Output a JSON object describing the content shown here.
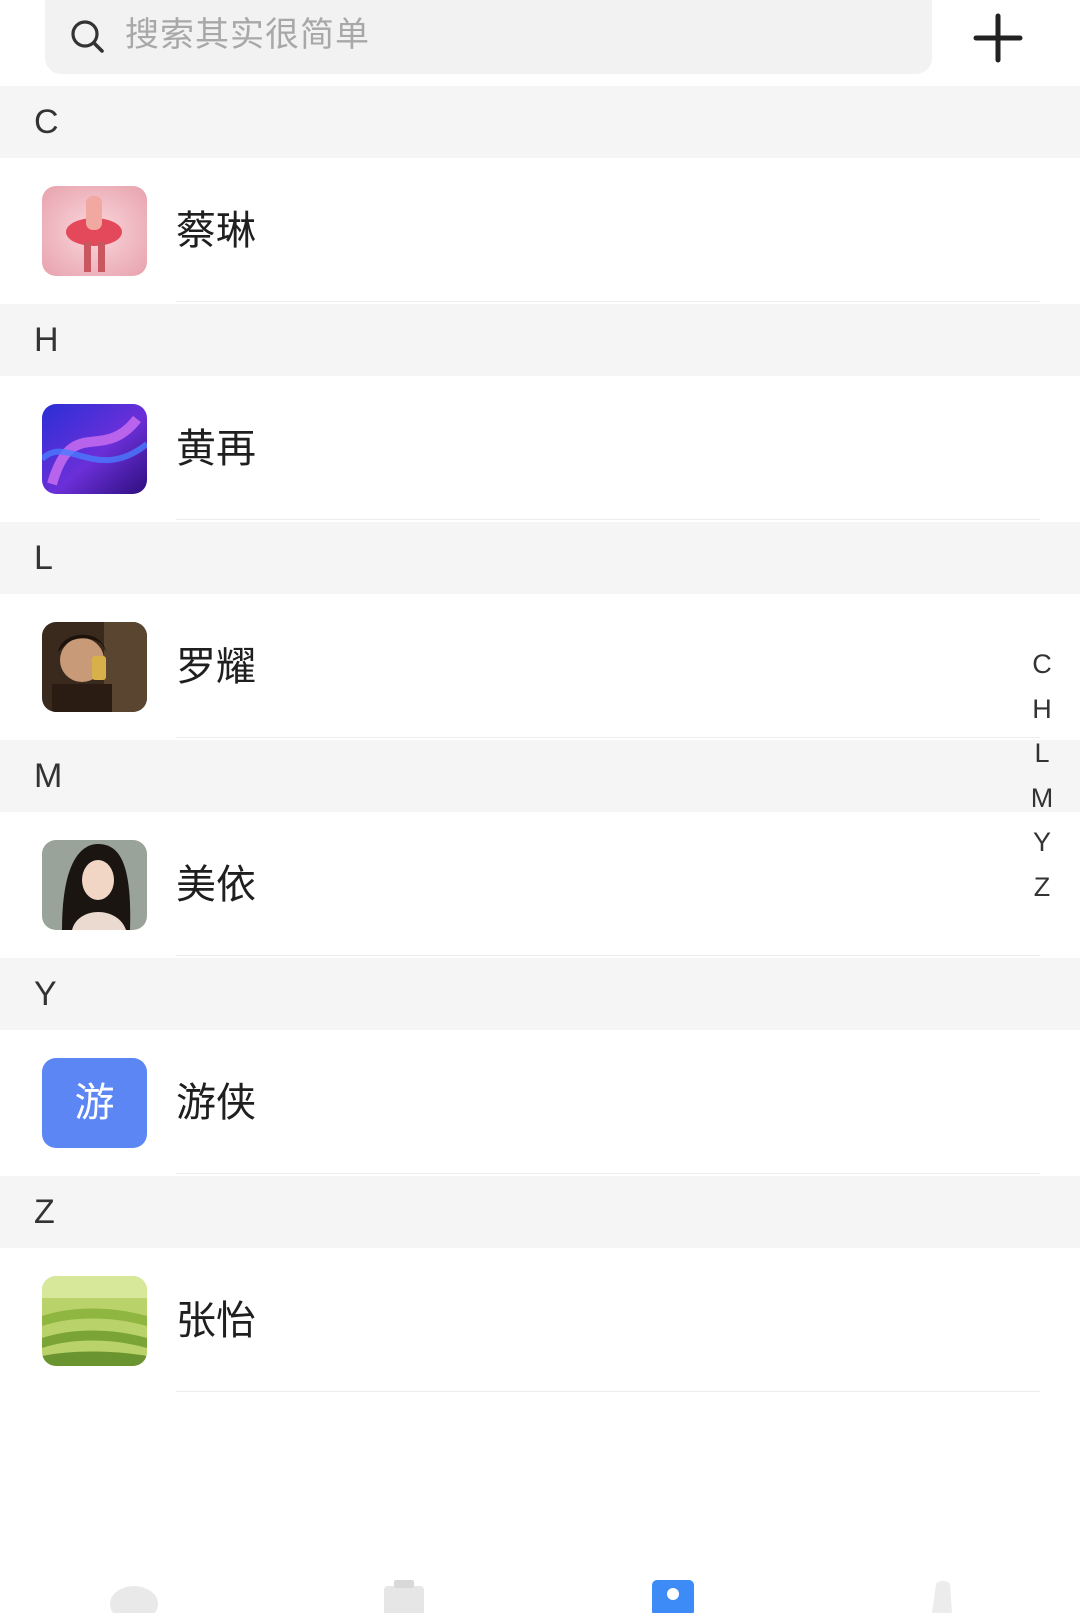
{
  "search": {
    "placeholder": "搜索其实很简单",
    "icon": "search-icon"
  },
  "header": {
    "add_icon": "plus-icon"
  },
  "sections": [
    {
      "letter": "C",
      "contacts": [
        {
          "name": "蔡琳",
          "avatar": "photo-ballet-dancer"
        }
      ]
    },
    {
      "letter": "H",
      "contacts": [
        {
          "name": "黄再",
          "avatar": "abstract-purple-wave"
        }
      ]
    },
    {
      "letter": "L",
      "contacts": [
        {
          "name": "罗耀",
          "avatar": "photo-man-selfie"
        }
      ]
    },
    {
      "letter": "M",
      "contacts": [
        {
          "name": "美依",
          "avatar": "photo-woman-portrait"
        }
      ]
    },
    {
      "letter": "Y",
      "contacts": [
        {
          "name": "游侠",
          "avatar_text": "游",
          "avatar_color": "#5b86f3"
        }
      ]
    },
    {
      "letter": "Z",
      "contacts": [
        {
          "name": "张怡",
          "avatar": "photo-green-field"
        }
      ]
    }
  ],
  "index_bar": [
    "C",
    "H",
    "L",
    "M",
    "Y",
    "Z"
  ],
  "bottom_nav": {
    "items": [
      "chat-icon",
      "contacts-card-icon",
      "person-icon",
      "more-icon"
    ],
    "active_index": 2,
    "active_color": "#3d8bf6"
  }
}
